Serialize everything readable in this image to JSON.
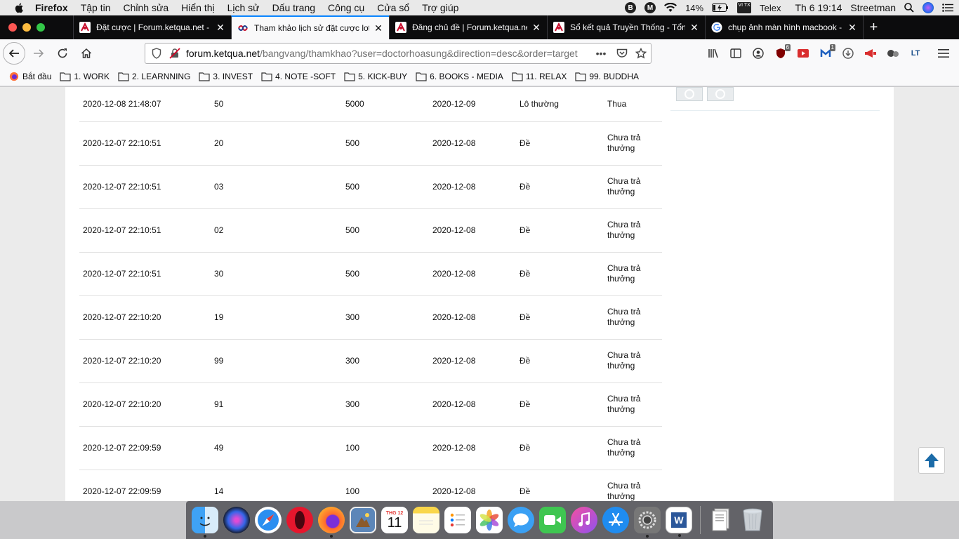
{
  "menubar": {
    "app_name": "Firefox",
    "items": [
      "Tập tin",
      "Chỉnh sửa",
      "Hiển thị",
      "Lịch sử",
      "Dấu trang",
      "Công cụ",
      "Cửa sổ",
      "Trợ giúp"
    ],
    "battery": "14%",
    "input_method": "Telex",
    "input_badge": "VI TX",
    "clock": "Th 6 19:14",
    "user": "Streetman"
  },
  "tabs": [
    {
      "title": "Đặt cược | Forum.ketqua.net - Trang",
      "active": false
    },
    {
      "title": "Tham khảo lịch sử đặt cược lotô",
      "active": true
    },
    {
      "title": "Đăng chủ đề | Forum.ketqua.net",
      "active": false
    },
    {
      "title": "Sổ kết quả Truyền Thống - Tổng",
      "active": false
    },
    {
      "title": "chụp ảnh màn hình macbook - Tìm",
      "active": false
    }
  ],
  "urlbar": {
    "domain": "forum.ketqua.net",
    "path": "/bangvang/thamkhao?user=doctorhoasung&direction=desc&order=target"
  },
  "toolbar": {
    "badge_ublock": "6",
    "badge_ext": "1",
    "lt_label": "LT"
  },
  "bookmarks": [
    {
      "label": "Bắt đầu",
      "type": "firefox"
    },
    {
      "label": "1. WORK",
      "type": "folder"
    },
    {
      "label": "2. LEARNNING",
      "type": "folder"
    },
    {
      "label": "3. INVEST",
      "type": "folder"
    },
    {
      "label": "4. NOTE -SOFT",
      "type": "folder"
    },
    {
      "label": "5. KICK-BUY",
      "type": "folder"
    },
    {
      "label": "6. BOOKS - MEDIA",
      "type": "folder"
    },
    {
      "label": "11. RELAX",
      "type": "folder"
    },
    {
      "label": "99. BUDDHA",
      "type": "folder"
    }
  ],
  "bets": [
    {
      "time": "2020-12-08 21:48:07",
      "number": "50",
      "amount": "5000",
      "date": "2020-12-09",
      "type": "Lô thường",
      "status": "Thua"
    },
    {
      "time": "2020-12-07 22:10:51",
      "number": "20",
      "amount": "500",
      "date": "2020-12-08",
      "type": "Đề",
      "status": "Chưa trả thưởng"
    },
    {
      "time": "2020-12-07 22:10:51",
      "number": "03",
      "amount": "500",
      "date": "2020-12-08",
      "type": "Đề",
      "status": "Chưa trả thưởng"
    },
    {
      "time": "2020-12-07 22:10:51",
      "number": "02",
      "amount": "500",
      "date": "2020-12-08",
      "type": "Đề",
      "status": "Chưa trả thưởng"
    },
    {
      "time": "2020-12-07 22:10:51",
      "number": "30",
      "amount": "500",
      "date": "2020-12-08",
      "type": "Đề",
      "status": "Chưa trả thưởng"
    },
    {
      "time": "2020-12-07 22:10:20",
      "number": "19",
      "amount": "300",
      "date": "2020-12-08",
      "type": "Đề",
      "status": "Chưa trả thưởng"
    },
    {
      "time": "2020-12-07 22:10:20",
      "number": "99",
      "amount": "300",
      "date": "2020-12-08",
      "type": "Đề",
      "status": "Chưa trả thưởng"
    },
    {
      "time": "2020-12-07 22:10:20",
      "number": "91",
      "amount": "300",
      "date": "2020-12-08",
      "type": "Đề",
      "status": "Chưa trả thưởng"
    },
    {
      "time": "2020-12-07 22:09:59",
      "number": "49",
      "amount": "100",
      "date": "2020-12-08",
      "type": "Đề",
      "status": "Chưa trả thưởng"
    },
    {
      "time": "2020-12-07 22:09:59",
      "number": "14",
      "amount": "100",
      "date": "2020-12-08",
      "type": "Đề",
      "status": "Chưa trả thưởng"
    }
  ],
  "dock": {
    "calendar_month": "THG 12",
    "calendar_day": "11",
    "word_letter": "W",
    "apps": [
      "finder",
      "siri",
      "safari",
      "opera",
      "firefox",
      "preview",
      "calendar",
      "notes",
      "reminders",
      "photos",
      "messages",
      "facetime",
      "itunes",
      "app-store",
      "system-preferences",
      "word",
      "documents",
      "trash"
    ]
  },
  "colors": {
    "accent": "#0a84ff",
    "scroll_top_arrow": "#1b6ba8"
  }
}
